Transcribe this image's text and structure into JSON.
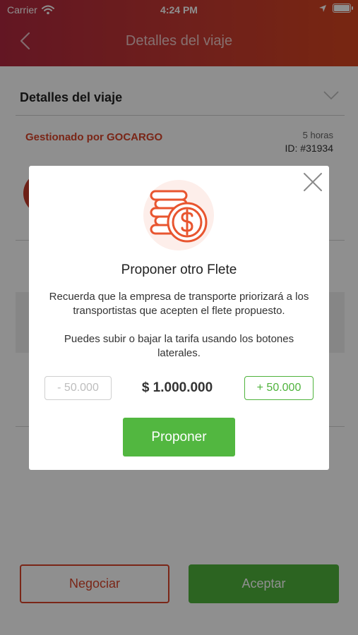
{
  "status_bar": {
    "carrier": "Carrier",
    "time": "4:24 PM"
  },
  "nav": {
    "title": "Detalles del viaje"
  },
  "page": {
    "section_title": "Detalles del viaje",
    "managed_by": "Gestionado por GOCARGO",
    "time_ago": "5 horas",
    "trip_id": "ID: #31934"
  },
  "modal": {
    "title": "Proponer otro Flete",
    "text_priority": "Recuerda que la empresa de transporte priorizará a los transportistas que acepten el flete propuesto.",
    "text_adjust": "Puedes subir o bajar la tarifa usando los botones laterales.",
    "minus_label": "- 50.000",
    "price": "$ 1.000.000",
    "plus_label": "+ 50.000",
    "submit_label": "Proponer"
  },
  "actions": {
    "negotiate_label": "Negociar",
    "accept_label": "Aceptar"
  },
  "colors": {
    "brand_red": "#d9452a",
    "accept_green": "#4fb33c",
    "header_gradient_start": "#b0283f",
    "header_gradient_end": "#d6451f"
  }
}
